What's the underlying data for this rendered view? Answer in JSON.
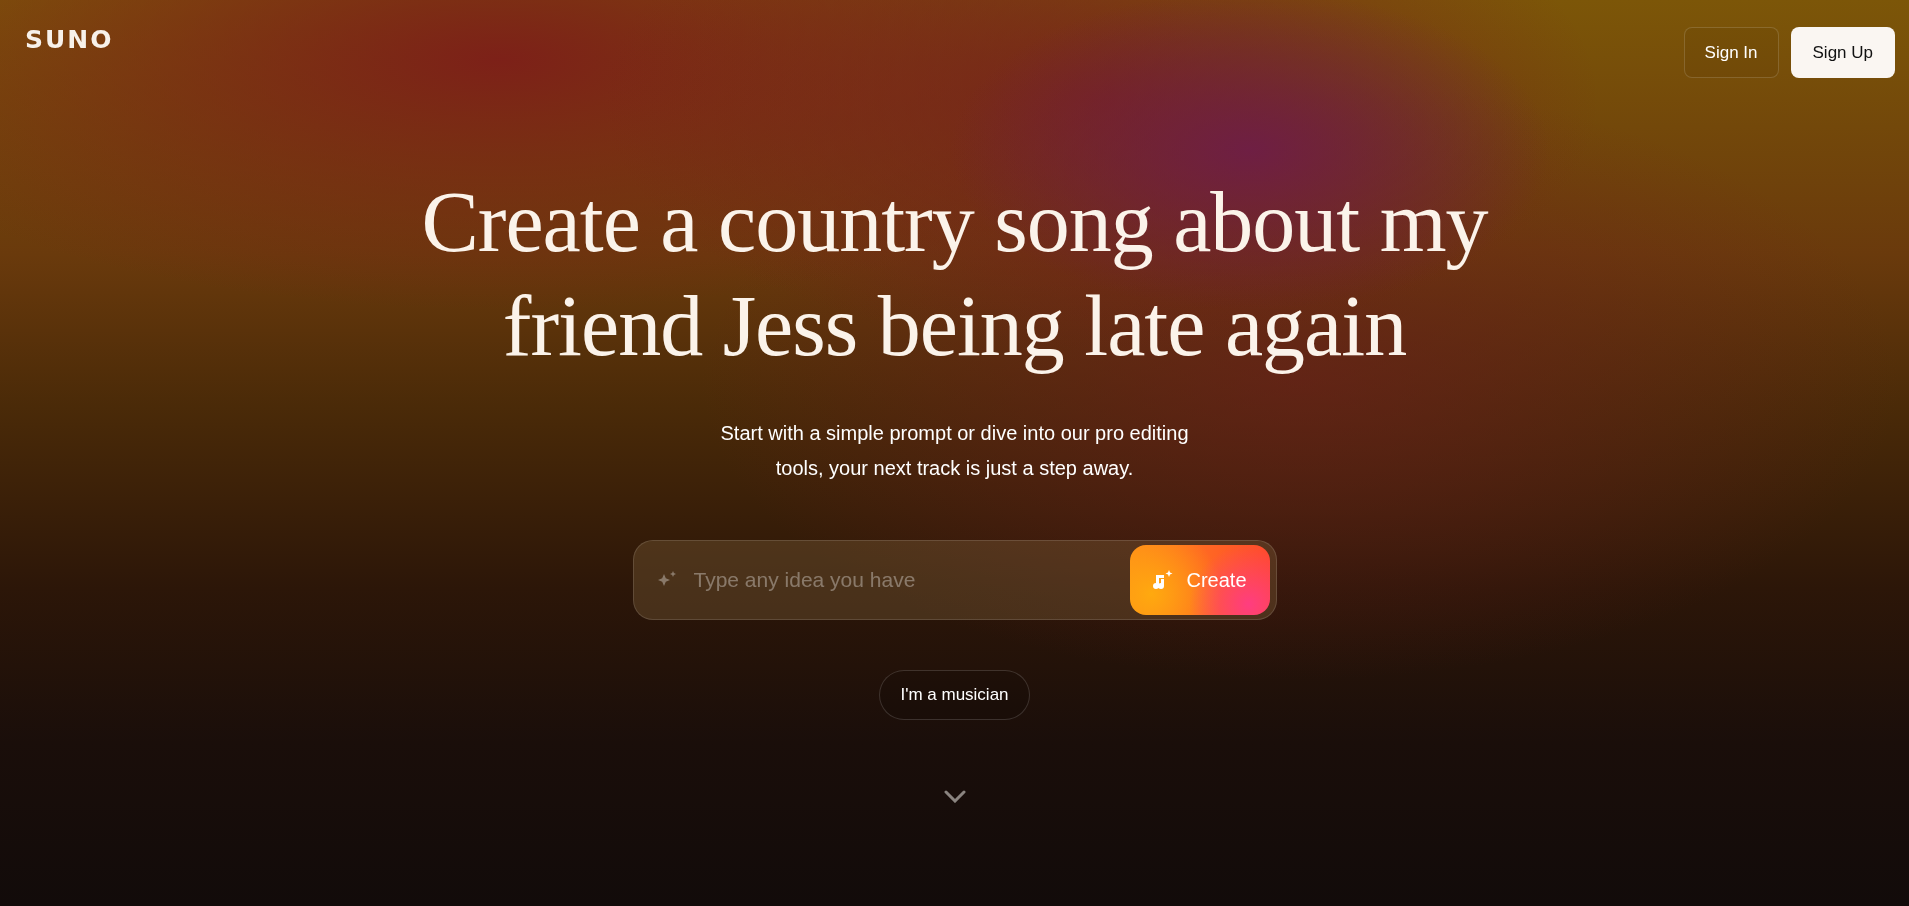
{
  "header": {
    "logo": "SUNO",
    "buttons": [
      {
        "label": "Sign In",
        "kind": "outline"
      },
      {
        "label": "Sign Up",
        "kind": "solid"
      }
    ]
  },
  "hero": {
    "title": "Create a country song about my friend Jess being late again",
    "subtitle": "Start with a simple prompt or dive into our pro editing tools, your next track is just a step away.",
    "prompt": {
      "placeholder": "Type any idea you have",
      "button": "Create"
    },
    "secondary_button": "I'm a musician"
  }
}
